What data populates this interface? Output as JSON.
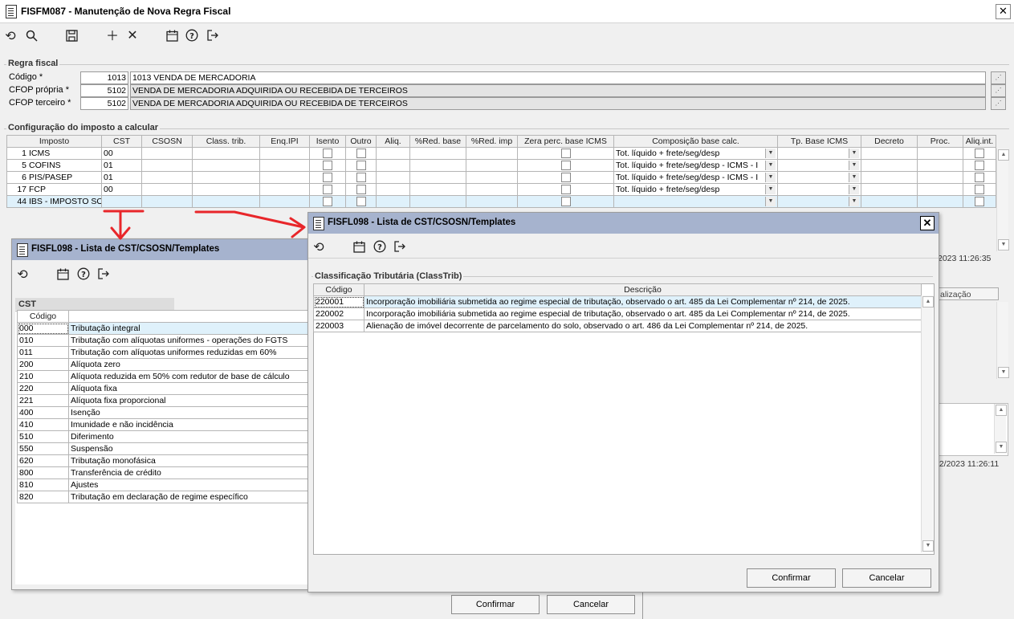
{
  "window": {
    "title": "FISFM087 - Manutenção de Nova Regra Fiscal",
    "close": "✕"
  },
  "regra": {
    "group_label": "Regra fiscal",
    "codigo_label": "Código *",
    "codigo_value": "1013",
    "codigo_desc": "1013 VENDA DE MERCADORIA",
    "cfop_propria_label": "CFOP própria *",
    "cfop_propria_value": "5102",
    "cfop_propria_desc": "VENDA DE MERCADORIA ADQUIRIDA OU RECEBIDA DE TERCEIROS",
    "cfop_terceiro_label": "CFOP terceiro *",
    "cfop_terceiro_value": "5102",
    "cfop_terceiro_desc": "VENDA DE MERCADORIA ADQUIRIDA OU RECEBIDA DE TERCEIROS"
  },
  "imposto": {
    "group_label": "Configuração do imposto a calcular",
    "columns": [
      "Imposto",
      "CST",
      "CSOSN",
      "Class. trib.",
      "Enq.IPI",
      "Isento",
      "Outro",
      "Aliq.",
      "%Red. base",
      "%Red. imp",
      "Zera perc. base ICMS",
      "Composição base calc.",
      "Tp. Base ICMS",
      "Decreto",
      "Proc.",
      "Aliq.int."
    ],
    "rows": [
      {
        "num": "1",
        "name": "ICMS",
        "cst": "00",
        "comp": "Tot. líquido + frete/seg/desp"
      },
      {
        "num": "5",
        "name": "COFINS",
        "cst": "01",
        "comp": "Tot. líquido + frete/seg/desp - ICMS - I"
      },
      {
        "num": "6",
        "name": "PIS/PASEP",
        "cst": "01",
        "comp": "Tot. líquido + frete/seg/desp - ICMS - I"
      },
      {
        "num": "17",
        "name": "FCP",
        "cst": "00",
        "comp": "Tot. líquido + frete/seg/desp"
      },
      {
        "num": "44",
        "name": "IBS - IMPOSTO SO",
        "cst": "",
        "comp": ""
      }
    ],
    "timestamp": "2023 11:26:35"
  },
  "background": {
    "tab_label": "alização",
    "timestamp2": "02/2023 11:26:11"
  },
  "list_left": {
    "title": "FISFL098 - Lista de CST/CSOSN/Templates",
    "group_label": "CST",
    "col_codigo": "Código",
    "rows": [
      {
        "code": "000",
        "desc": "Tributação integral"
      },
      {
        "code": "010",
        "desc": "Tributação com alíquotas uniformes - operações do FGTS"
      },
      {
        "code": "011",
        "desc": "Tributação com alíquotas uniformes reduzidas em 60%"
      },
      {
        "code": "200",
        "desc": "Alíquota zero"
      },
      {
        "code": "210",
        "desc": "Alíquota reduzida em 50% com redutor de base de cálculo"
      },
      {
        "code": "220",
        "desc": "Alíquota fixa"
      },
      {
        "code": "221",
        "desc": "Alíquota fixa proporcional"
      },
      {
        "code": "400",
        "desc": "Isenção"
      },
      {
        "code": "410",
        "desc": "Imunidade e não incidência"
      },
      {
        "code": "510",
        "desc": "Diferimento"
      },
      {
        "code": "550",
        "desc": "Suspensão"
      },
      {
        "code": "620",
        "desc": "Tributação monofásica"
      },
      {
        "code": "800",
        "desc": "Transferência de crédito"
      },
      {
        "code": "810",
        "desc": "Ajustes"
      },
      {
        "code": "820",
        "desc": "Tributação em declaração de regime específico"
      }
    ],
    "confirm": "Confirmar",
    "cancel": "Cancelar"
  },
  "list_right": {
    "title": "FISFL098 - Lista de CST/CSOSN/Templates",
    "close": "✕",
    "group_label": "Classificação Tributária (ClassTrib)",
    "col_codigo": "Código",
    "col_desc": "Descrição",
    "rows": [
      {
        "code": "220001",
        "desc": "Incorporação imobiliária submetida ao regime especial de tributação, observado o art. 485 da Lei Complementar nº 214, de 2025."
      },
      {
        "code": "220002",
        "desc": "Incorporação imobiliária submetida ao regime especial de tributação, observado o art. 485 da Lei Complementar nº 214, de 2025."
      },
      {
        "code": "220003",
        "desc": "Alienação de imóvel decorrente de parcelamento do solo, observado o art. 486 da Lei Complementar nº 214, de 2025."
      }
    ],
    "confirm": "Confirmar",
    "cancel": "Cancelar"
  },
  "colors": {
    "panel_title": "#a6b3ce",
    "selected_row": "#dff1fb",
    "arrow": "#e8262a"
  }
}
